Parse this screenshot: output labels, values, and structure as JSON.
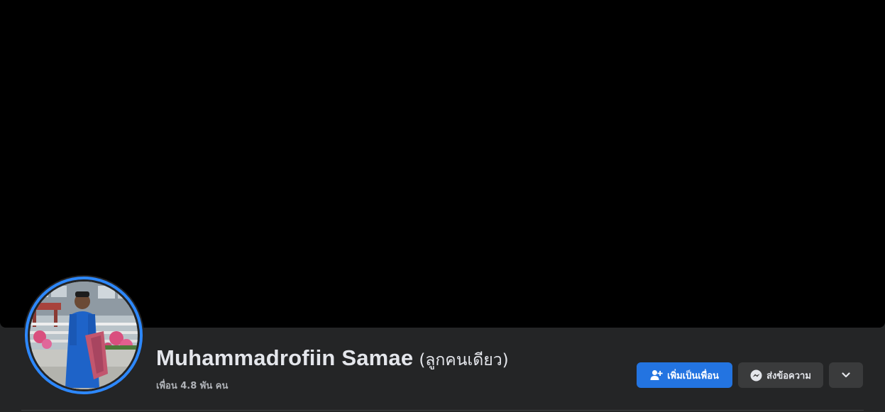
{
  "profile": {
    "name": "Muhammadrofiin Samae",
    "alternate_name": "(ลูกคนเดียว)",
    "friends_count": "เพื่อน 4.8 พัน คน"
  },
  "actions": {
    "add_friend_label": "เพิ่มเป็นเพื่อน",
    "message_label": "ส่งข้อความ",
    "more_icon": "chevron-down-icon"
  },
  "colors": {
    "background": "#242526",
    "cover": "#000000",
    "primary_button": "#2374e1",
    "secondary_button": "#3a3b3c",
    "avatar_ring": "#2d88ff"
  }
}
